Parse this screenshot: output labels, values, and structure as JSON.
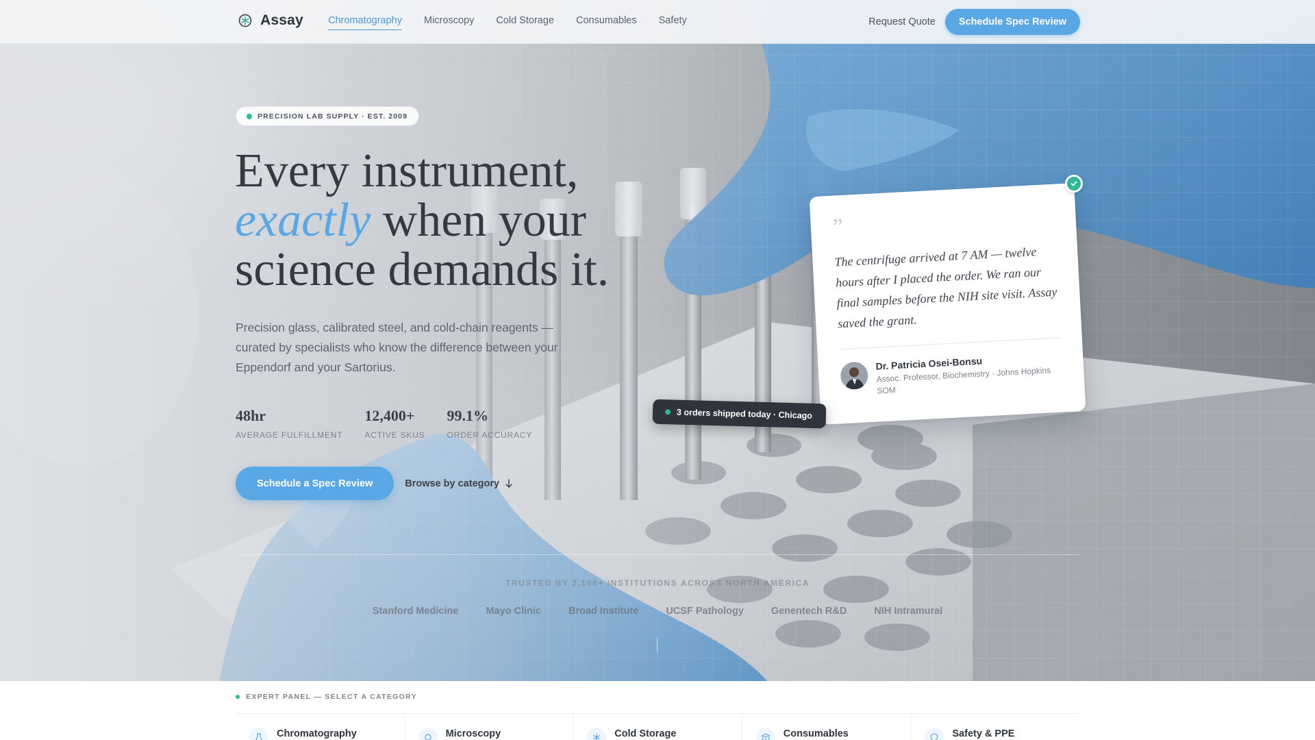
{
  "brand": {
    "name": "Assay",
    "logo_icon": "flask-snowflake-icon",
    "accent_color": "#5aa7e6"
  },
  "nav": {
    "links": [
      {
        "label": "Chromatography",
        "active": true
      },
      {
        "label": "Microscopy",
        "active": false
      },
      {
        "label": "Cold Storage",
        "active": false
      },
      {
        "label": "Consumables",
        "active": false
      },
      {
        "label": "Safety",
        "active": false
      }
    ],
    "request_quote": "Request Quote",
    "cta": "Schedule Spec Review"
  },
  "hero": {
    "eyebrow": "PRECISION LAB SUPPLY · EST. 2009",
    "headline_line1": "Every instrument,",
    "headline_em": "exactly",
    "headline_line2_rest": " when your",
    "headline_line3": "science demands it.",
    "lede": "Precision glass, calibrated steel, and cold-chain reagents — curated by specialists who know the difference between your Eppendorf and your Sartorius.",
    "stats": [
      {
        "value": "48hr",
        "label": "AVERAGE FULFILLMENT"
      },
      {
        "value": "12,400+",
        "label": "ACTIVE SKUS"
      },
      {
        "value": "99.1%",
        "label": "ORDER ACCURACY"
      }
    ],
    "cta_primary": "Schedule a Spec Review",
    "cta_secondary": "Browse by category",
    "cta_secondary_icon": "arrow-down-icon"
  },
  "testimonial": {
    "quote_mark": "”",
    "text": "The centrifuge arrived at 7 AM — twelve hours after I placed the order. We ran our final samples before the NIH site visit. Assay saved the grant.",
    "author_name": "Dr. Patricia Osei-Bonsu",
    "author_role": "Assoc. Professor, Biochemistry · Johns Hopkins SOM",
    "badge_icon": "check-icon"
  },
  "ship_notice": "3 orders shipped today · Chicago",
  "trust": {
    "label": "TRUSTED BY 2,100+ INSTITUTIONS ACROSS NORTH AMERICA",
    "logos": [
      "Stanford Medicine",
      "Mayo Clinic",
      "Broad Institute",
      "UCSF Pathology",
      "Genentech R&D",
      "NIH Intramural"
    ]
  },
  "panel": {
    "label": "EXPERT PANEL — SELECT A CATEGORY",
    "categories": [
      {
        "name": "Chromatography",
        "icon": "flask-icon"
      },
      {
        "name": "Microscopy",
        "icon": "lens-icon"
      },
      {
        "name": "Cold Storage",
        "icon": "snowflake-icon"
      },
      {
        "name": "Consumables",
        "icon": "box-icon"
      },
      {
        "name": "Safety & PPE",
        "icon": "shield-icon"
      }
    ]
  }
}
